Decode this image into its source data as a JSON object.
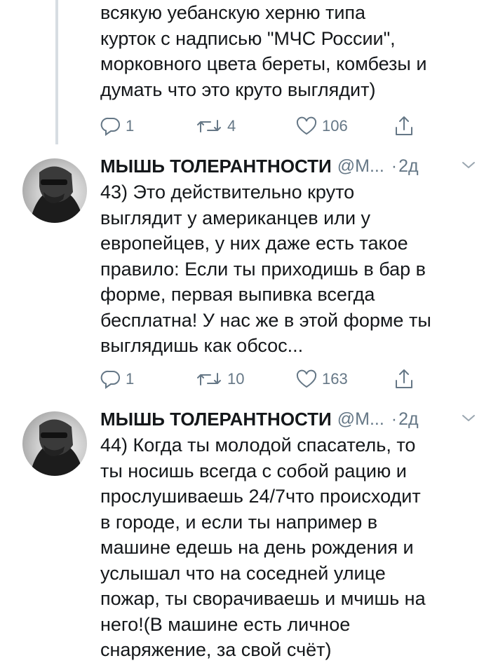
{
  "tweets": [
    {
      "text": "всякую уебанскую херню типа\nкурток с надписью \"МЧС России\",\nморковного цвета береты, комбезы и\nдумать что это круто выглядит)",
      "replies": "1",
      "retweets": "4",
      "likes": "106"
    },
    {
      "author_name": "МЫШЬ ТОЛЕРАНТНОСТИ",
      "handle": "@М...",
      "separator": "·",
      "time": "2д",
      "text": "43) Это действительно круто\nвыглядит у американцев или у\nевропейцев, у них даже есть такое\nправило: Если ты приходишь в бар в\nформе, первая выпивка всегда\nбесплатна! У нас же в этой форме ты\nвыглядишь как обсос...",
      "replies": "1",
      "retweets": "10",
      "likes": "163"
    },
    {
      "author_name": "МЫШЬ ТОЛЕРАНТНОСТИ",
      "handle": "@М...",
      "separator": "·",
      "time": "2д",
      "text": "44) Когда ты молодой спасатель, то\nты носишь всегда с собой рацию и\nпрослушиваешь 24/7что происходит\nв городе, и если ты например в\nмашине едешь на день рождения и\nуслышал что на соседней улице\nпожар, ты сворачиваешь и мчишь на\nнего!(В машине есть личное\nснаряжение, за свой счёт)"
    }
  ],
  "icons": {
    "reply": "reply-icon",
    "retweet": "retweet-icon",
    "like": "heart-icon",
    "share": "share-icon",
    "menu": "chevron-down-icon"
  },
  "colors": {
    "text": "#14171a",
    "secondary": "#657786",
    "thread_line": "#d7dde2"
  }
}
